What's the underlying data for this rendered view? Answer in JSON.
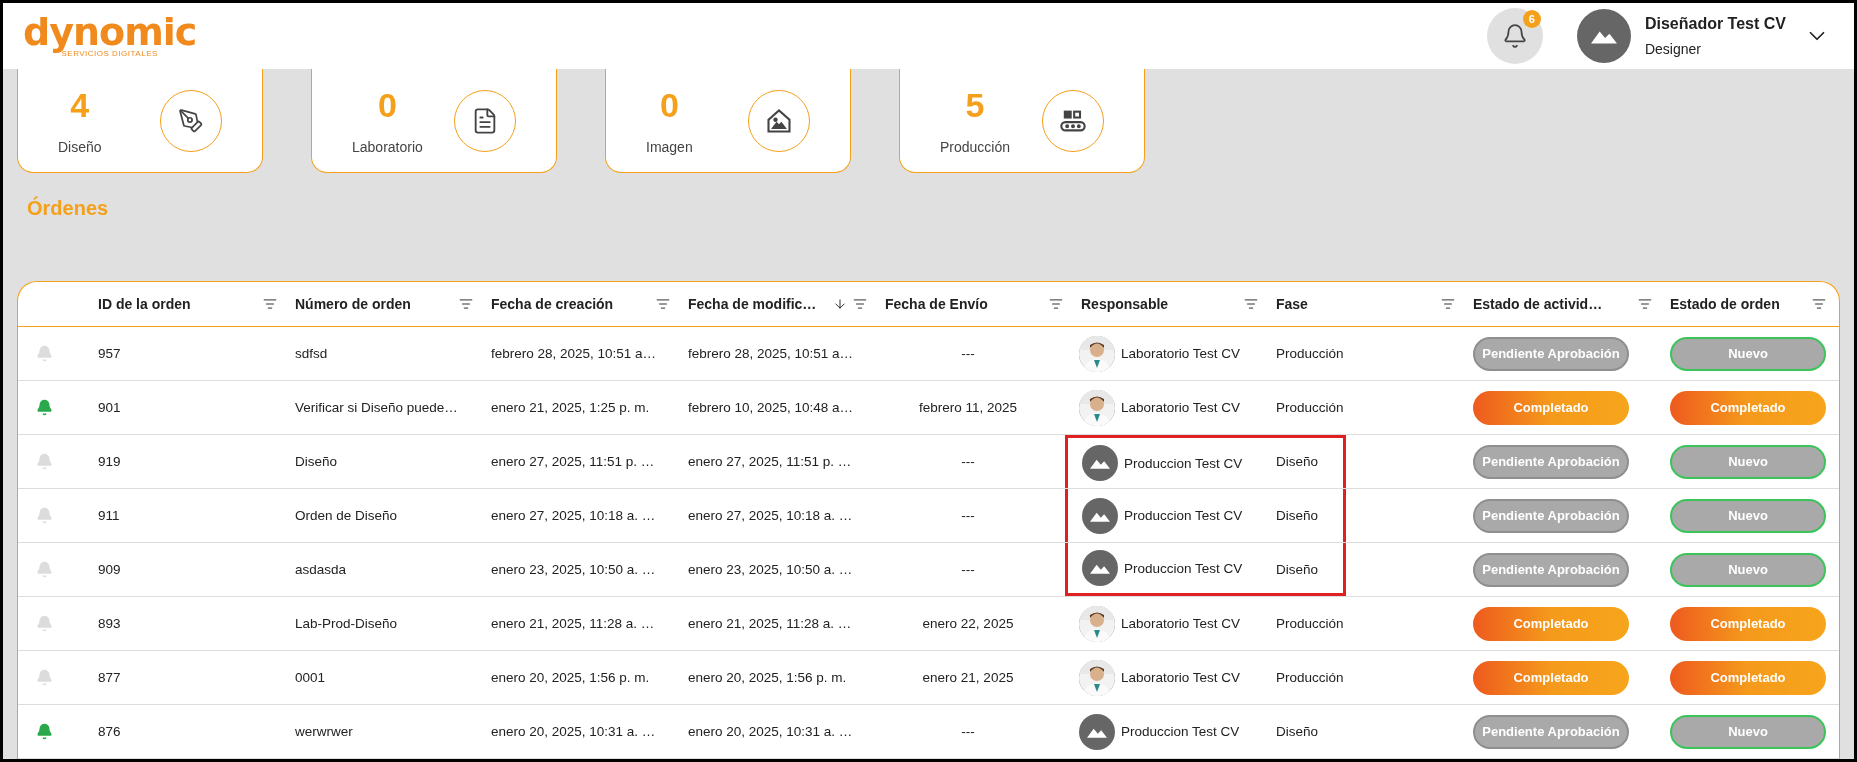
{
  "header": {
    "logo": "dynomic",
    "tagline": "SERVICIOS DIGITALES",
    "notifications": "6",
    "user": {
      "name": "Diseñador Test CV",
      "role": "Designer"
    }
  },
  "stats": [
    {
      "value": "4",
      "label": "Diseño",
      "kind": "pen"
    },
    {
      "value": "0",
      "label": "Laboratorio",
      "kind": "document"
    },
    {
      "value": "0",
      "label": "Imagen",
      "kind": "house"
    },
    {
      "value": "5",
      "label": "Producción",
      "kind": "conveyor"
    }
  ],
  "section_title": "Órdenes",
  "table": {
    "columns": [
      {
        "label": "ID de la orden",
        "sorted": false
      },
      {
        "label": "Número de orden",
        "sorted": false
      },
      {
        "label": "Fecha de creación",
        "sorted": false
      },
      {
        "label": "Fecha de modific…",
        "sorted": true
      },
      {
        "label": "Fecha de Envío",
        "sorted": false
      },
      {
        "label": "Responsable",
        "sorted": false
      },
      {
        "label": "Fase",
        "sorted": false
      },
      {
        "label": "Estado de activid…",
        "sorted": false
      },
      {
        "label": "Estado de orden",
        "sorted": false
      }
    ],
    "rows": [
      {
        "notified": false,
        "id": "957",
        "number": "sdfsd",
        "created": "febrero 28, 2025, 10:51 a…",
        "modified": "febrero 28, 2025, 10:51 a…",
        "sent": "---",
        "responsible": "Laboratorio Test CV",
        "highlighted": false,
        "phase": "Producción",
        "activity": {
          "label": "Pendiente Aprobación",
          "kind": "pending"
        },
        "order": {
          "label": "Nuevo",
          "kind": "new"
        }
      },
      {
        "notified": true,
        "id": "901",
        "number": "Verificar si Diseño puede…",
        "created": "enero 21, 2025, 1:25 p. m.",
        "modified": "febrero 10, 2025, 10:48 a…",
        "sent": "febrero 11, 2025",
        "responsible": "Laboratorio Test CV",
        "highlighted": false,
        "phase": "Producción",
        "activity": {
          "label": "Completado",
          "kind": "completed"
        },
        "order": {
          "label": "Completado",
          "kind": "completed"
        }
      },
      {
        "notified": false,
        "id": "919",
        "number": "Diseño",
        "created": "enero 27, 2025, 11:51 p. …",
        "modified": "enero 27, 2025, 11:51 p. …",
        "sent": "---",
        "avatar": {
          "kind": "placeholder"
        },
        "responsible": "Produccion Test CV",
        "highlighted": true,
        "phase": "Diseño",
        "activity": {
          "label": "Pendiente Aprobación",
          "kind": "pending"
        },
        "order": {
          "label": "Nuevo",
          "kind": "new"
        }
      },
      {
        "notified": false,
        "id": "911",
        "number": "Orden de Diseño",
        "created": "enero 27, 2025, 10:18 a. …",
        "modified": "enero 27, 2025, 10:18 a. …",
        "sent": "---",
        "avatar": {
          "kind": "placeholder"
        },
        "responsible": "Produccion Test CV",
        "highlighted": true,
        "phase": "Diseño",
        "activity": {
          "label": "Pendiente Aprobación",
          "kind": "pending"
        },
        "order": {
          "label": "Nuevo",
          "kind": "new"
        }
      },
      {
        "notified": false,
        "id": "909",
        "number": "asdasda",
        "created": "enero 23, 2025, 10:50 a. …",
        "modified": "enero 23, 2025, 10:50 a. …",
        "sent": "---",
        "avatar": {
          "kind": "placeholder"
        },
        "responsible": "Produccion Test CV",
        "highlighted": true,
        "phase": "Diseño",
        "activity": {
          "label": "Pendiente Aprobación",
          "kind": "pending"
        },
        "order": {
          "label": "Nuevo",
          "kind": "new"
        }
      },
      {
        "notified": false,
        "id": "893",
        "number": "Lab-Prod-Diseño",
        "created": "enero 21, 2025, 11:28 a. …",
        "modified": "enero 21, 2025, 11:28 a. …",
        "sent": "enero 22, 2025",
        "responsible": "Laboratorio Test CV",
        "highlighted": false,
        "phase": "Producción",
        "activity": {
          "label": "Completado",
          "kind": "completed"
        },
        "order": {
          "label": "Completado",
          "kind": "completed"
        }
      },
      {
        "notified": false,
        "id": "877",
        "number": "0001",
        "created": "enero 20, 2025, 1:56 p. m.",
        "modified": "enero 20, 2025, 1:56 p. m.",
        "sent": "enero 21, 2025",
        "responsible": "Laboratorio Test CV",
        "highlighted": false,
        "phase": "Producción",
        "activity": {
          "label": "Completado",
          "kind": "completed"
        },
        "order": {
          "label": "Completado",
          "kind": "completed"
        }
      },
      {
        "notified": true,
        "id": "876",
        "number": "werwrwer",
        "created": "enero 20, 2025, 10:31 a. …",
        "modified": "enero 20, 2025, 10:31 a. …",
        "sent": "---",
        "avatar": {
          "kind": "placeholder"
        },
        "responsible": "Produccion Test CV",
        "highlighted": false,
        "phase": "Diseño",
        "activity": {
          "label": "Pendiente Aprobación",
          "kind": "pending"
        },
        "order": {
          "label": "Nuevo",
          "kind": "new"
        }
      }
    ]
  }
}
